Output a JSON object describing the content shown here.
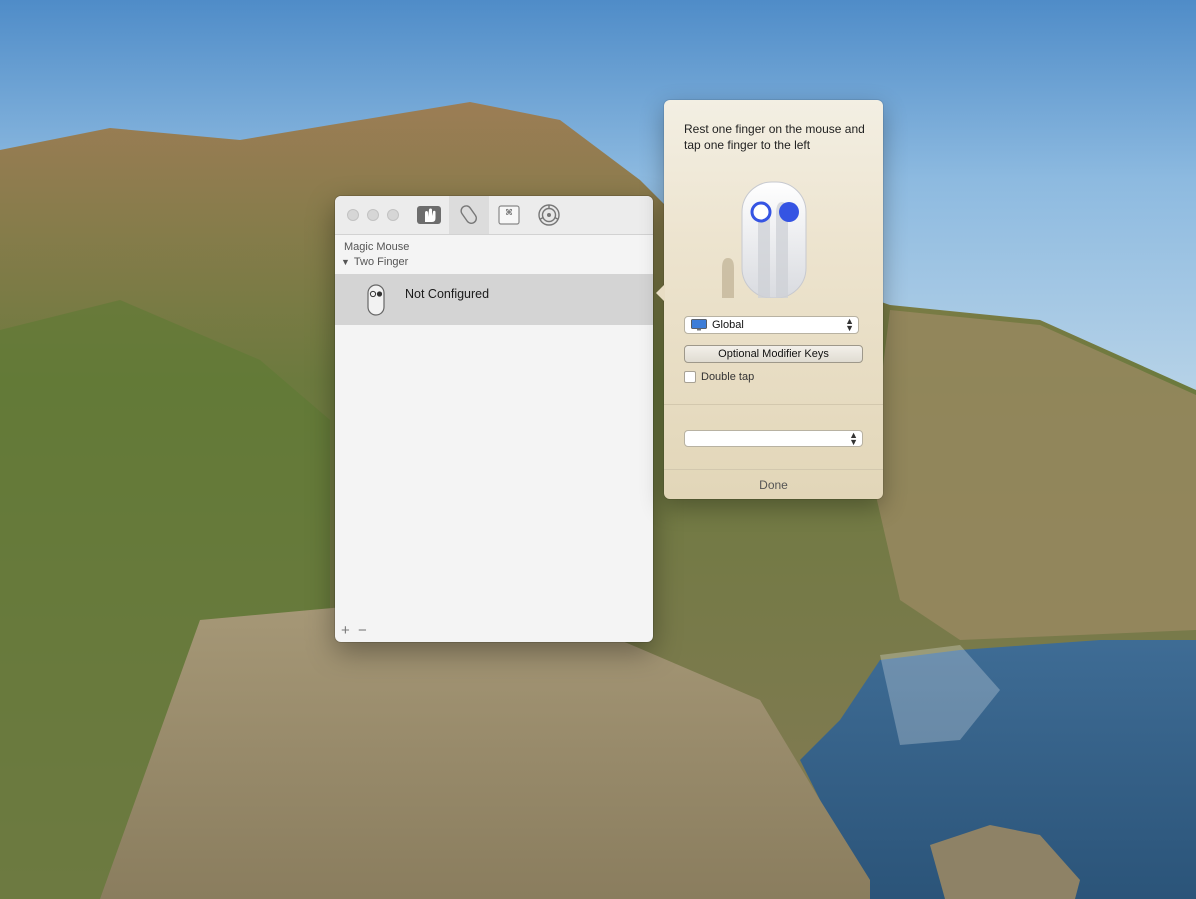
{
  "window": {
    "toolbar": {
      "tabs": [
        {
          "icon": "trackpad-gesture-icon",
          "selected": false
        },
        {
          "icon": "magic-mouse-icon",
          "selected": true
        },
        {
          "icon": "keyboard-shortcut-icon",
          "selected": false
        },
        {
          "icon": "gear-settings-icon",
          "selected": false
        }
      ]
    },
    "device_label": "Magic Mouse",
    "group_label": "Two Finger",
    "group_expanded_glyph": "▼",
    "gestures": [
      {
        "label": "Not Configured",
        "selected": true
      }
    ],
    "add_label": "+",
    "remove_label": "−"
  },
  "popover": {
    "instruction": "Rest one finger on the mouse and tap one finger to the left",
    "app_select": {
      "value": "Global"
    },
    "modifier_button_label": "Optional Modifier Keys",
    "double_tap_label": "Double tap",
    "double_tap_checked": false,
    "action_select": {
      "value": ""
    },
    "done_label": "Done"
  },
  "colors": {
    "finger_blue": "#3554e3",
    "selection_gray": "#d4d4d4"
  }
}
